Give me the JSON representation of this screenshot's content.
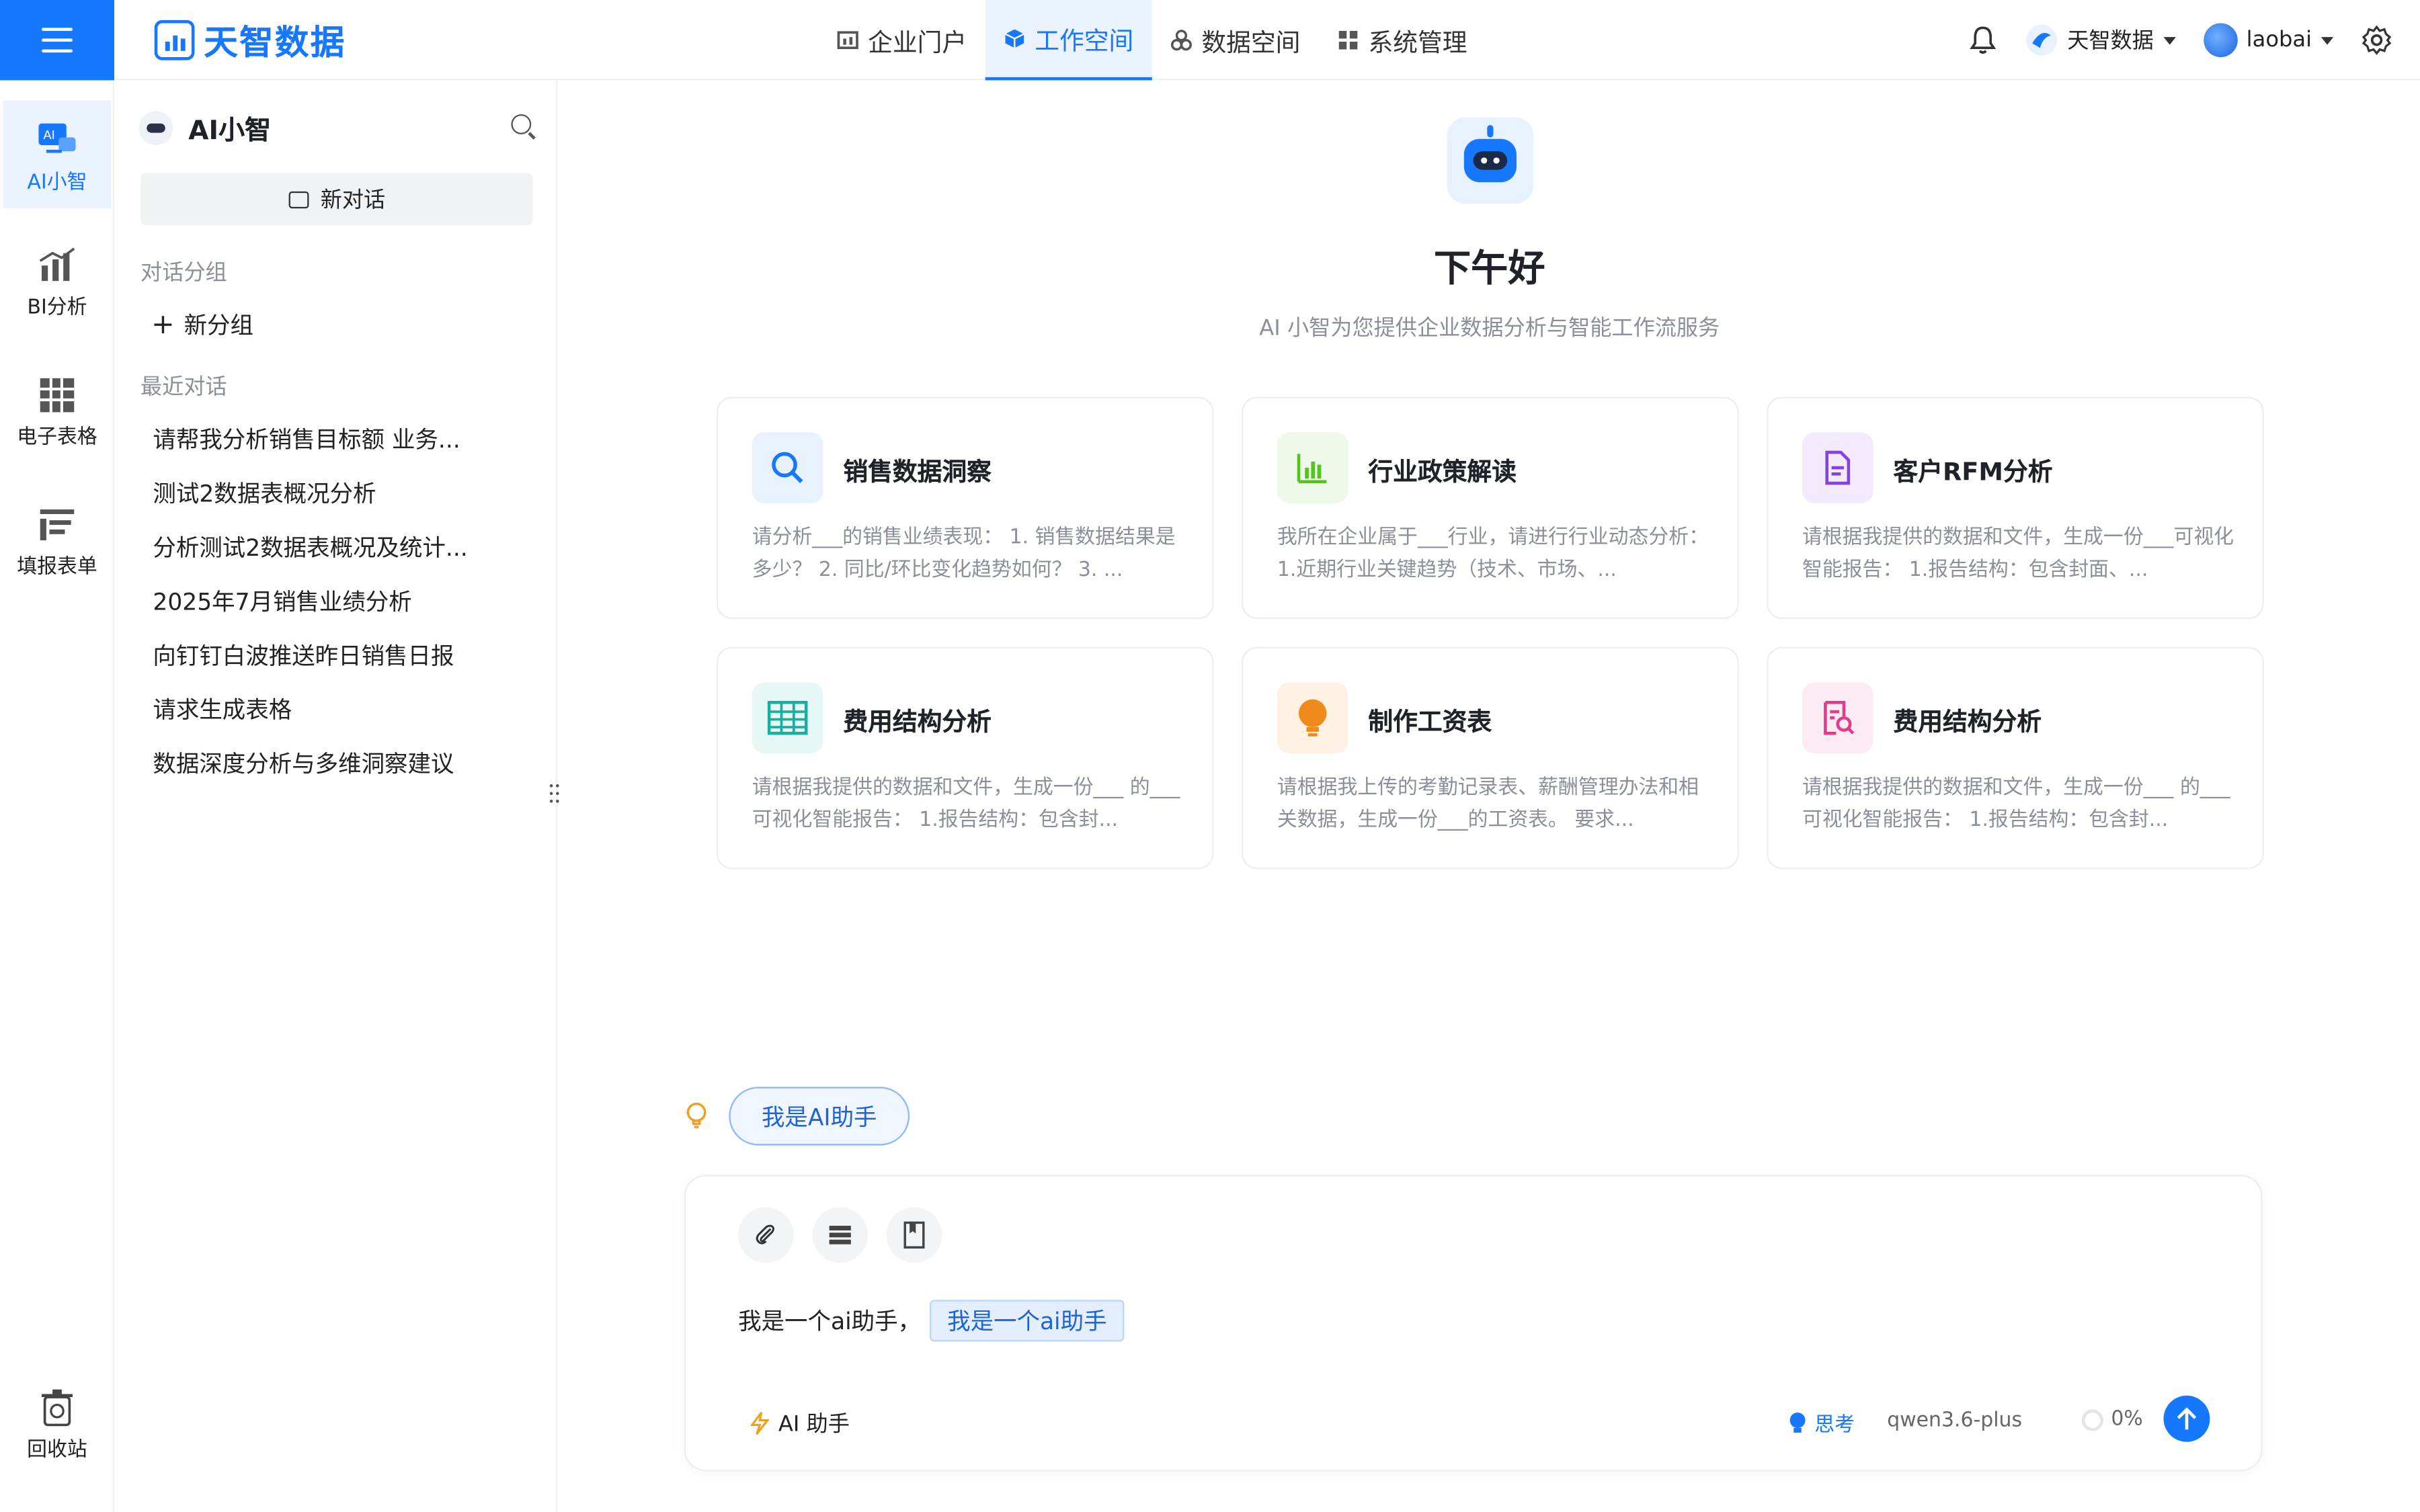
{
  "header": {
    "brand": "天智数据",
    "tabs": [
      {
        "label": "企业门户",
        "icon": "portal-icon",
        "active": false
      },
      {
        "label": "工作空间",
        "icon": "cube-icon",
        "active": true
      },
      {
        "label": "数据空间",
        "icon": "data-space-icon",
        "active": false
      },
      {
        "label": "系统管理",
        "icon": "grid-icon",
        "active": false
      }
    ],
    "org_name": "天智数据",
    "user_name": "laobai"
  },
  "rail": {
    "items": [
      {
        "label": "AI小智",
        "icon": "ai-icon",
        "active": true
      },
      {
        "label": "BI分析",
        "icon": "bar-chart-icon",
        "active": false
      },
      {
        "label": "电子表格",
        "icon": "spreadsheet-icon",
        "active": false
      },
      {
        "label": "填报表单",
        "icon": "form-icon",
        "active": false
      }
    ],
    "recycle_label": "回收站"
  },
  "panel": {
    "title": "AI小智",
    "new_chat_label": "新对话",
    "groups_label": "对话分组",
    "add_group_label": "新分组",
    "recent_label": "最近对话",
    "recent": [
      "请帮我分析销售目标额 业务...",
      "测试2数据表概况分析",
      "分析测试2数据表概况及统计...",
      "2025年7月销售业绩分析",
      "向钉钉白波推送昨日销售日报",
      "请求生成表格",
      "数据深度分析与多维洞察建议"
    ]
  },
  "main": {
    "greeting": "下午好",
    "subtitle": "AI 小智为您提供企业数据分析与智能工作流服务",
    "cards": [
      {
        "title": "销售数据洞察",
        "desc": "请分析___的销售业绩表现： 1. 销售数据结果是多少？ 2. 同比/环比变化趋势如何？ 3. ...",
        "icon": "search-icon",
        "color": "#1677ff",
        "bg": "#e8f1ff"
      },
      {
        "title": "行业政策解读",
        "desc": "我所在企业属于___行业，请进行行业动态分析： 1.近期行业关键趋势（技术、市场、...",
        "icon": "bar-chart-icon",
        "color": "#52c41a",
        "bg": "#eef9ea"
      },
      {
        "title": "客户RFM分析",
        "desc": "请根据我提供的数据和文件，生成一份___可视化智能报告： 1.报告结构：包含封面、...",
        "icon": "document-icon",
        "color": "#8a3fe0",
        "bg": "#f3ebfd"
      },
      {
        "title": "费用结构分析",
        "desc": "请根据我提供的数据和文件，生成一份___ 的___可视化智能报告： 1.报告结构：包含封...",
        "icon": "table-icon",
        "color": "#16b0a0",
        "bg": "#e6f8f5"
      },
      {
        "title": "制作工资表",
        "desc": "请根据我上传的考勤记录表、薪酬管理办法和相关数据，生成一份___的工资表。 要求...",
        "icon": "lightbulb-icon",
        "color": "#f08a1a",
        "bg": "#fff1e3"
      },
      {
        "title": "费用结构分析",
        "desc": "请根据我提供的数据和文件，生成一份___ 的___可视化智能报告： 1.报告结构：包含封...",
        "icon": "doc-search-icon",
        "color": "#e03c8a",
        "bg": "#fdebf3"
      }
    ],
    "suggest_chip": "我是AI助手",
    "composer": {
      "text": "我是一个ai助手，",
      "chip": "我是一个ai助手",
      "helper_label": "AI 助手",
      "think_label": "思考",
      "model": "qwen3.6-plus",
      "context_pct": "0%"
    }
  }
}
